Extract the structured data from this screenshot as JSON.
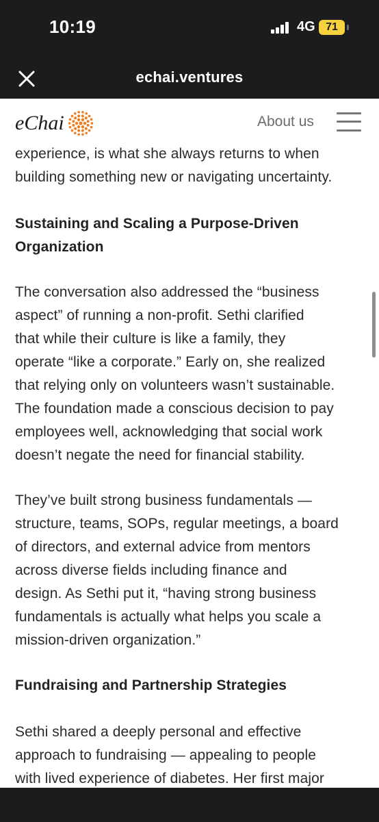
{
  "status_bar": {
    "time": "10:19",
    "network": "4G",
    "battery": "71",
    "battery_color": "#f6d23f"
  },
  "browser": {
    "url": "echai.ventures",
    "close_icon": "close-icon"
  },
  "site": {
    "logo_text": "eChai",
    "logo_color": "#f07d1f",
    "nav_about": "About us",
    "menu_icon": "hamburger-menu-icon"
  },
  "article": {
    "para0_line1": "experience, is what she always returns to when",
    "para0_line2": "building something new or navigating uncertainty.",
    "heading1_line1": "Sustaining and Scaling a Purpose-Driven",
    "heading1_line2": "Organization",
    "para1_lines": [
      "The conversation also addressed the “business",
      "aspect” of running a non-profit. Sethi clarified",
      "that while their culture is like a family, they",
      "operate “like a corporate.” Early on, she realized",
      "that relying only on volunteers wasn’t sustainable.",
      "The foundation made a conscious decision to pay",
      "employees well, acknowledging that social work",
      "doesn’t negate the need for financial stability."
    ],
    "para2_lines": [
      "They’ve built strong business fundamentals —",
      "structure, teams, SOPs, regular meetings, a board",
      "of directors, and external advice from mentors",
      "across diverse fields including finance and",
      "design. As Sethi put it, “having strong business",
      "fundamentals is actually what helps you scale a",
      "mission-driven organization.”"
    ],
    "heading2": "Fundraising and Partnership Strategies",
    "para3_lines": [
      "Sethi shared a deeply personal and effective",
      "approach to fundraising — appealing to people",
      "with lived experience of diabetes. Her first major"
    ]
  }
}
